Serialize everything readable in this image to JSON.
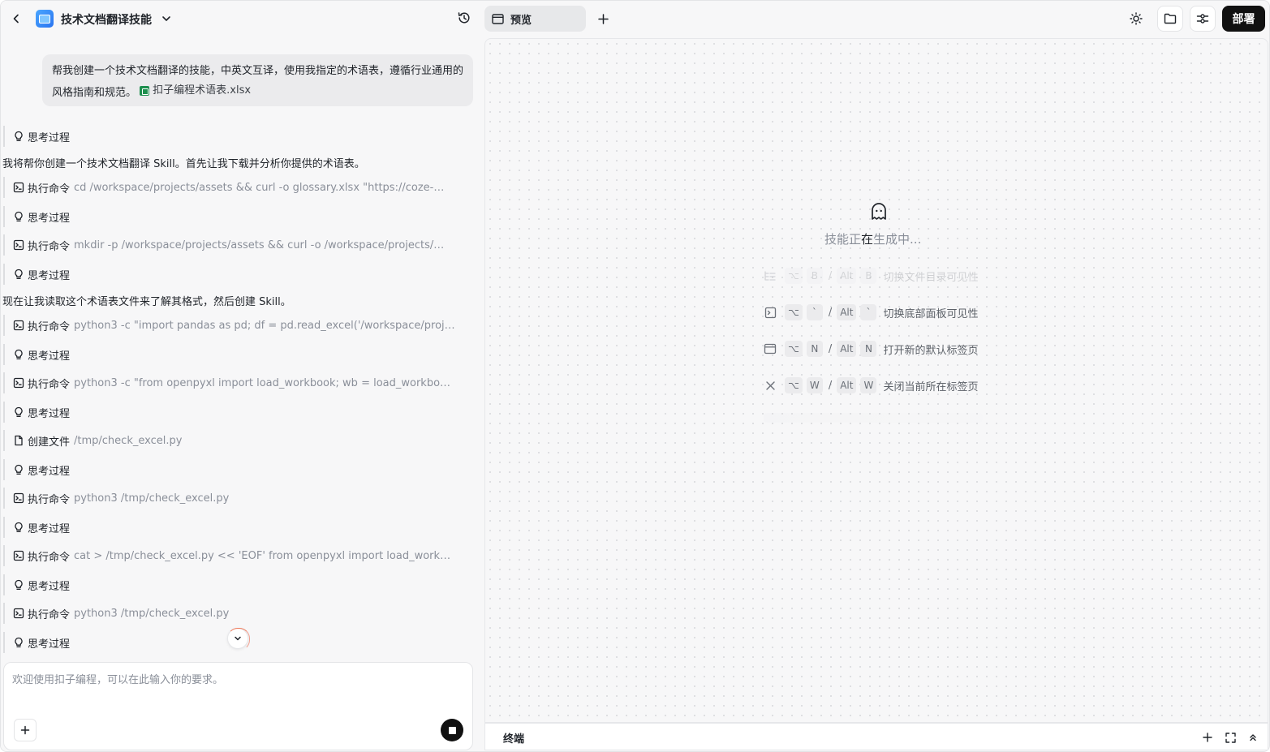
{
  "header": {
    "app_title": "技术文档翻译技能"
  },
  "chat": {
    "user_message": "帮我创建一个技术文档翻译的技能，中英文互译，使用我指定的术语表，遵循行业通用的风格指南和规范。",
    "attachment_name": "扣子编程术语表.xlsx",
    "items": [
      {
        "kind": "thinking",
        "label": "思考过程"
      },
      {
        "kind": "text",
        "text": "我将帮你创建一个技术文档翻译 Skill。首先让我下载并分析你提供的术语表。"
      },
      {
        "kind": "exec",
        "label": "执行命令",
        "detail": "cd /workspace/projects/assets && curl -o glossary.xlsx \"https://coze-…"
      },
      {
        "kind": "thinking",
        "label": "思考过程"
      },
      {
        "kind": "exec",
        "label": "执行命令",
        "detail": "mkdir -p /workspace/projects/assets && curl -o /workspace/projects/…"
      },
      {
        "kind": "thinking",
        "label": "思考过程"
      },
      {
        "kind": "text",
        "text": "现在让我读取这个术语表文件来了解其格式，然后创建 Skill。"
      },
      {
        "kind": "exec",
        "label": "执行命令",
        "detail": "python3 -c \"import pandas as pd; df = pd.read_excel('/workspace/proj…"
      },
      {
        "kind": "thinking",
        "label": "思考过程"
      },
      {
        "kind": "exec",
        "label": "执行命令",
        "detail": "python3 -c \"from openpyxl import load_workbook; wb = load_workbook…"
      },
      {
        "kind": "thinking",
        "label": "思考过程"
      },
      {
        "kind": "file",
        "label": "创建文件",
        "detail": "/tmp/check_excel.py"
      },
      {
        "kind": "thinking",
        "label": "思考过程"
      },
      {
        "kind": "exec",
        "label": "执行命令",
        "detail": "python3 /tmp/check_excel.py"
      },
      {
        "kind": "thinking",
        "label": "思考过程"
      },
      {
        "kind": "exec",
        "label": "执行命令",
        "detail": "cat > /tmp/check_excel.py << 'EOF' from openpyxl import load_workbo…"
      },
      {
        "kind": "thinking",
        "label": "思考过程"
      },
      {
        "kind": "exec",
        "label": "执行命令",
        "detail": "python3 /tmp/check_excel.py"
      },
      {
        "kind": "thinking",
        "label": "思考过程"
      }
    ],
    "input_placeholder": "欢迎使用扣子编程，可以在此输入你的要求。"
  },
  "preview": {
    "tab_label": "预览",
    "status_pre": "技能正",
    "status_highlight": "在",
    "status_post": "生成中...",
    "shortcuts": [
      {
        "icon": "folder-tree-icon",
        "mac_keys": [
          "⌥",
          "B"
        ],
        "alt_keys": [
          "Alt",
          "B"
        ],
        "desc": "切换文件目录可见性"
      },
      {
        "icon": "terminal-icon",
        "mac_keys": [
          "⌥",
          "`"
        ],
        "alt_keys": [
          "Alt",
          "`"
        ],
        "desc": "切换底部面板可见性"
      },
      {
        "icon": "browser-tab-icon",
        "mac_keys": [
          "⌥",
          "N"
        ],
        "alt_keys": [
          "Alt",
          "N"
        ],
        "desc": "打开新的默认标签页"
      },
      {
        "icon": "close-icon",
        "mac_keys": [
          "⌥",
          "W"
        ],
        "alt_keys": [
          "Alt",
          "W"
        ],
        "desc": "关闭当前所在标签页"
      }
    ]
  },
  "toolbar": {
    "deploy_label": "部署"
  },
  "terminal": {
    "label": "终端"
  }
}
